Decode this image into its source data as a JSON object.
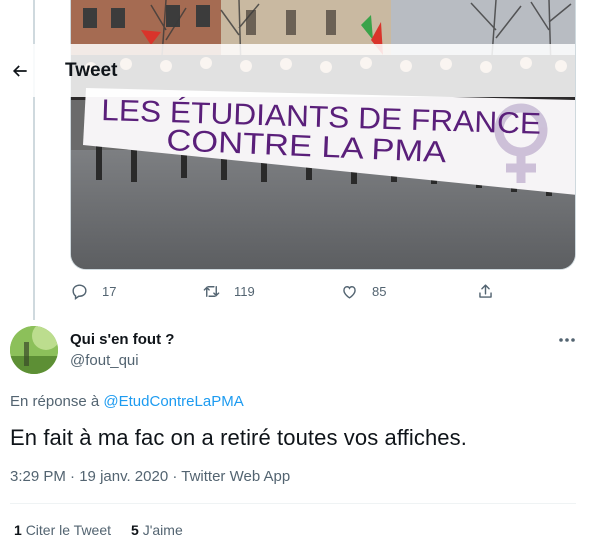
{
  "header": {
    "title": "Tweet",
    "back_icon": "arrow-left-icon"
  },
  "banner": {
    "line1": "LES ÉTUDIANTS DE FRANCE",
    "line2": "CONTRE LA PMA"
  },
  "parent_actions": {
    "reply_count": "17",
    "retweet_count": "119",
    "like_count": "85",
    "icons": [
      "reply-icon",
      "retweet-icon",
      "like-icon",
      "share-icon"
    ]
  },
  "tweet": {
    "author_name": "Qui s'en fout ?",
    "author_handle": "@fout_qui",
    "reply_prefix": "En réponse à ",
    "reply_to_handle": "@EtudContreLaPMA",
    "text": "En fait à ma fac on a retiré toutes vos affiches.",
    "time": "3:29 PM",
    "separator": " · ",
    "date": "19 janv. 2020",
    "source": "Twitter Web App"
  },
  "stats": {
    "quote_count": "1",
    "quote_label": "Citer le Tweet",
    "like_count": "5",
    "like_label": "J'aime"
  },
  "colors": {
    "accent": "#1d9bf0",
    "muted": "#536471",
    "text": "#0f1419",
    "banner_text": "#5a1f7a"
  }
}
